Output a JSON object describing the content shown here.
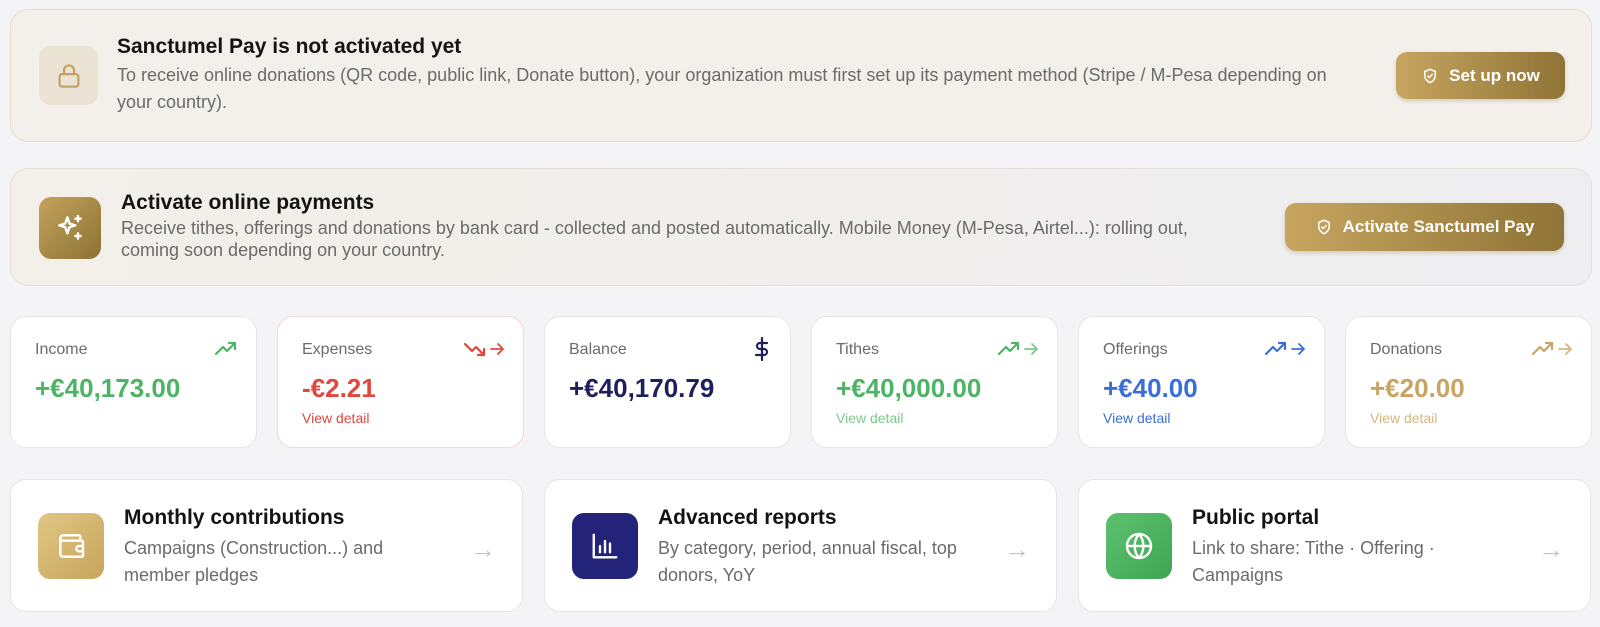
{
  "warning_banner": {
    "title": "Sanctumel Pay is not activated yet",
    "text": "To receive online donations (QR code, public link, Donate button), your organization must first set up its payment method (Stripe / M‑Pesa depending on your country).",
    "button_label": "Set up now",
    "icon": "lock-icon"
  },
  "activate_banner": {
    "title": "Activate online payments",
    "text": "Receive tithes, offerings and donations by bank card - collected and posted automatically. Mobile Money (M‑Pesa, Airtel...): rolling out, coming soon depending on your country.",
    "button_label": "Activate Sanctumel Pay",
    "icon": "sparkle-icon"
  },
  "stats": [
    {
      "label": "Income",
      "value": "+€40,173.00",
      "link": "",
      "color": "#4cb464",
      "icon": "trending-up-icon"
    },
    {
      "label": "Expenses",
      "value": "-€2.21",
      "link": "View detail",
      "color": "#e0483e",
      "icon": "trending-down-icon"
    },
    {
      "label": "Balance",
      "value": "+€40,170.79",
      "link": "",
      "color": "#1f1f5e",
      "icon": "dollar-icon"
    },
    {
      "label": "Tithes",
      "value": "+€40,000.00",
      "link": "View detail",
      "color": "#4cb464",
      "icon": "trending-up-icon"
    },
    {
      "label": "Offerings",
      "value": "+€40.00",
      "link": "View detail",
      "color": "#3a6fd8",
      "icon": "trending-up-icon"
    },
    {
      "label": "Donations",
      "value": "+€20.00",
      "link": "View detail",
      "color": "#c9a563",
      "icon": "trending-up-icon"
    }
  ],
  "cards": [
    {
      "title": "Monthly contributions",
      "desc": "Campaigns (Construction...) and member pledges",
      "icon": "wallet-icon",
      "icon_bg": "#d2b46c"
    },
    {
      "title": "Advanced reports",
      "desc": "By category, period, annual fiscal, top donors, YoY",
      "icon": "bar-chart-icon",
      "icon_bg": "#24237a"
    },
    {
      "title": "Public portal",
      "desc": "Link to share: Tithe · Offering · Campaigns",
      "icon": "globe-icon",
      "icon_bg": "#4db660"
    }
  ]
}
